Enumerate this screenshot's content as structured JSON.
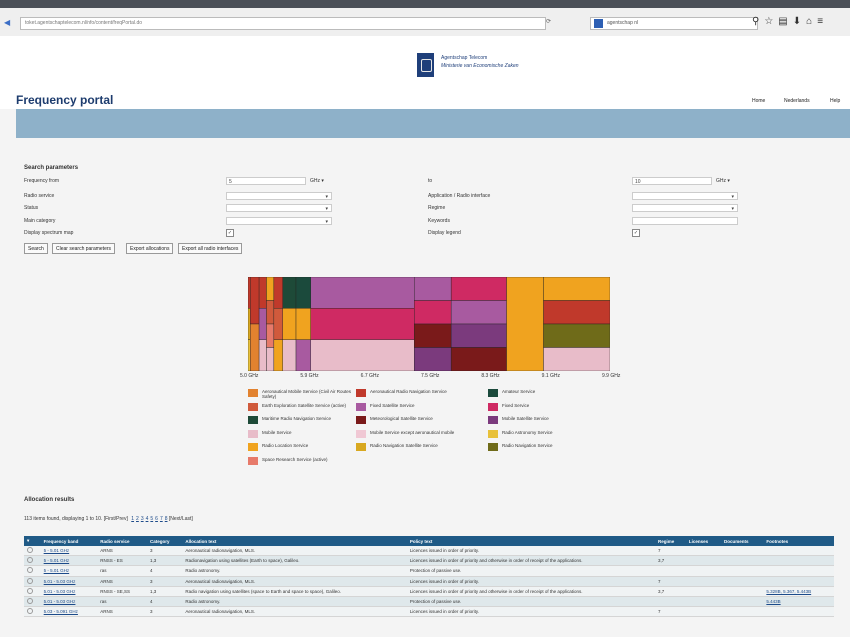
{
  "browser": {
    "url": "toket.agentschaptelecom.nl/nfo/content/freqPortal.do",
    "search_value": "agentschap nl"
  },
  "header": {
    "org_name": "Agentschap Telecom",
    "ministry": "Ministerie van Economische Zaken",
    "portal_title": "Frequency portal",
    "links": [
      "Home",
      "Nederlands",
      "Help"
    ]
  },
  "search": {
    "title": "Search parameters",
    "freq_from_label": "Frequency from",
    "freq_from_value": "5",
    "freq_from_unit": "GHz",
    "to_label": "to",
    "to_value": "10",
    "to_unit": "GHz",
    "radio_service_label": "Radio service",
    "status_label": "Status",
    "main_category_label": "Main category",
    "display_spectrum_label": "Display spectrum map",
    "application_label": "Application / Radio interface",
    "regime_label": "Regime",
    "keywords_label": "Keywords",
    "display_legend_label": "Display legend",
    "buttons": [
      "Search",
      "Clear search parameters",
      "Export allocations",
      "Export all radio interfaces"
    ]
  },
  "chart_data": {
    "type": "heatmap",
    "x_ticks": [
      "5.0 GHz",
      "5.9 GHz",
      "6.7 GHz",
      "7.5 GHz",
      "8.3 GHz",
      "9.1 GHz",
      "9.9 GHz"
    ],
    "xlim": [
      5.0,
      9.9
    ],
    "legend": [
      {
        "label": "Aeronautical Mobile Service (Civil Air Routes Safety)",
        "color": "#e2822f"
      },
      {
        "label": "Aeronautical Radio Navigation Service",
        "color": "#c0392b"
      },
      {
        "label": "Amateur Service",
        "color": "#1b4a3c"
      },
      {
        "label": "Earth Exploration Satellite Service (active)",
        "color": "#d05a3c"
      },
      {
        "label": "Fixed Satellite Service",
        "color": "#a85aa0"
      },
      {
        "label": "Fixed Service",
        "color": "#cf2a63"
      },
      {
        "label": "Maritime Radio Navigation Service",
        "color": "#1e4a38"
      },
      {
        "label": "Meteorological Satellite Service",
        "color": "#7a1a1a"
      },
      {
        "label": "Mobile Satellite Service",
        "color": "#7b3a7d"
      },
      {
        "label": "Mobile Service",
        "color": "#e8bcc9"
      },
      {
        "label": "Mobile Service except aeronautical mobile",
        "color": "#f0c8d4"
      },
      {
        "label": "Radio Astronomy Service",
        "color": "#e8c13a"
      },
      {
        "label": "Radio Location Service",
        "color": "#f0a31f"
      },
      {
        "label": "Radio Navigation Satellite Service",
        "color": "#d8a820"
      },
      {
        "label": "Radio Navigation Service",
        "color": "#6f6b19"
      },
      {
        "label": "Space Research Service (active)",
        "color": "#e77a6a"
      }
    ],
    "bands": [
      {
        "from": 5.0,
        "to": 5.03,
        "services": [
          "Aeronautical Radio Navigation Service",
          "Radio Navigation Satellite Service",
          "Radio Astronomy Service"
        ]
      },
      {
        "from": 5.03,
        "to": 5.15,
        "services": [
          "Aeronautical Radio Navigation Service",
          "Aeronautical Mobile Service (Civil Air Routes Safety)"
        ]
      },
      {
        "from": 5.15,
        "to": 5.25,
        "services": [
          "Aeronautical Radio Navigation Service",
          "Fixed Satellite Service",
          "Mobile Service"
        ]
      },
      {
        "from": 5.25,
        "to": 5.35,
        "services": [
          "Radio Location Service",
          "Earth Exploration Satellite Service (active)",
          "Space Research Service (active)",
          "Mobile Service"
        ]
      },
      {
        "from": 5.35,
        "to": 5.47,
        "services": [
          "Aeronautical Radio Navigation Service",
          "Earth Exploration Satellite Service (active)",
          "Radio Location Service"
        ]
      },
      {
        "from": 5.47,
        "to": 5.65,
        "services": [
          "Maritime Radio Navigation Service",
          "Radio Location Service",
          "Mobile Service"
        ]
      },
      {
        "from": 5.65,
        "to": 5.85,
        "services": [
          "Amateur Service",
          "Radio Location Service",
          "Fixed Satellite Service"
        ]
      },
      {
        "from": 5.85,
        "to": 7.25,
        "services": [
          "Fixed Satellite Service",
          "Fixed Service",
          "Mobile Service"
        ]
      },
      {
        "from": 7.25,
        "to": 7.75,
        "services": [
          "Fixed Satellite Service",
          "Fixed Service",
          "Meteorological Satellite Service",
          "Mobile Satellite Service"
        ]
      },
      {
        "from": 7.75,
        "to": 8.5,
        "services": [
          "Fixed Service",
          "Fixed Satellite Service",
          "Mobile Satellite Service",
          "Meteorological Satellite Service"
        ]
      },
      {
        "from": 8.5,
        "to": 9.0,
        "services": [
          "Radio Location Service"
        ]
      },
      {
        "from": 9.0,
        "to": 9.9,
        "services": [
          "Radio Location Service",
          "Aeronautical Radio Navigation Service",
          "Radio Navigation Service",
          "Mobile Service"
        ]
      }
    ]
  },
  "results": {
    "title": "Allocation results",
    "summary": "113 items found, displaying 1 to 10.",
    "pager_first": "[First/Prev]",
    "pages": [
      "1",
      "2",
      "3",
      "4",
      "5",
      "6",
      "7",
      "8"
    ],
    "pager_last": "[Next/Last]",
    "columns": [
      "Frequency band",
      "Radio service",
      "Category",
      "Allocation text",
      "Policy text",
      "Regime",
      "Licenses",
      "Documents",
      "Footnotes"
    ],
    "rows": [
      [
        "5 - 5.01 GHz",
        "ARNS",
        "3",
        "Aeronautical radionavigation, MLS.",
        "Licences issued in order of priority.",
        "7",
        "",
        "",
        ""
      ],
      [
        "5 - 5.01 GHz",
        "RNSS - ES",
        "1,3",
        "Radionavigation using satellites (Earth to space), Galileo.",
        "Licences issued in order of priority and otherwise in order of receipt of the applications.",
        "3,7",
        "",
        "",
        ""
      ],
      [
        "5 - 5.01 GHz",
        "ras",
        "4",
        "Radio astronomy.",
        "Protection of passive use.",
        "",
        "",
        "",
        ""
      ],
      [
        "5.01 - 5.03 GHz",
        "ARNS",
        "3",
        "Aeronautical radionavigation, MLS.",
        "Licences issued in order of priority.",
        "7",
        "",
        "",
        ""
      ],
      [
        "5.01 - 5.03 GHz",
        "RNSS - SE,SS",
        "1,3",
        "Radio navigation using satellites (space to Earth and space to space), Galileo.",
        "Licences issued in order of priority and otherwise in order of receipt of the applications.",
        "3,7",
        "",
        "",
        "5.328B, 5.367, 5.443B"
      ],
      [
        "5.01 - 5.03 GHz",
        "ras",
        "4",
        "Radio astronomy.",
        "Protection of passive use.",
        "",
        "",
        "",
        "5.443B"
      ],
      [
        "5.03 - 5.091 GHz",
        "ARNS",
        "3",
        "Aeronautical radionavigation, MLS.",
        "Licences issued in order of priority.",
        "7",
        "",
        "",
        ""
      ]
    ]
  }
}
